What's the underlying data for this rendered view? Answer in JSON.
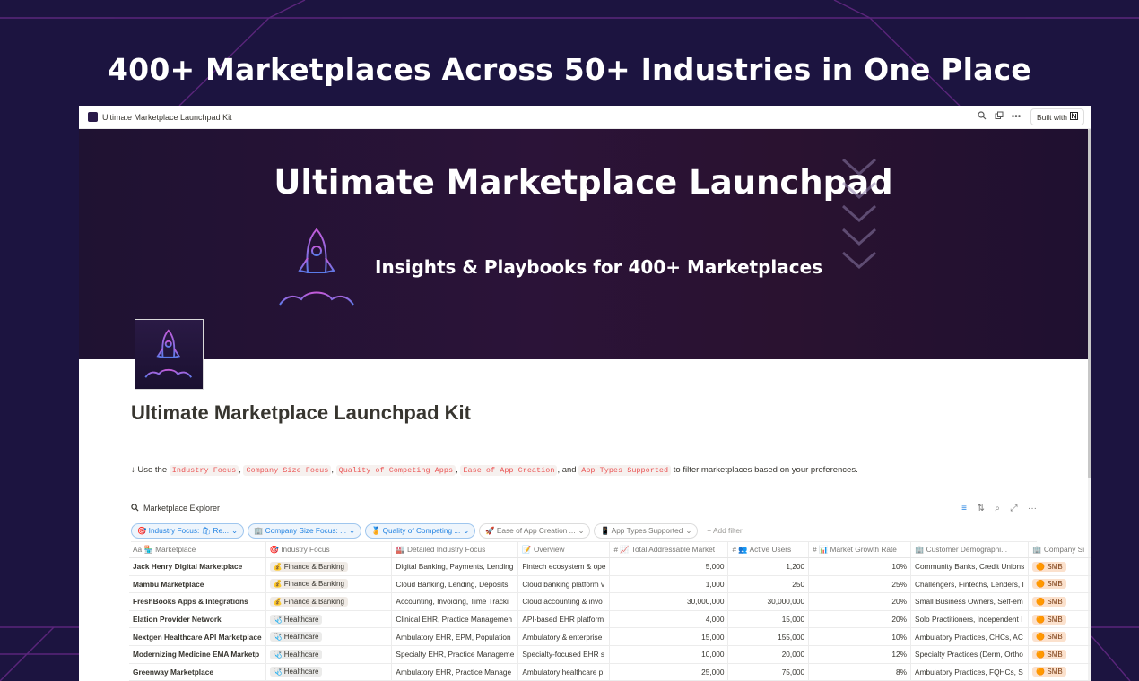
{
  "headline": "400+ Marketplaces Across 50+ Industries in One Place",
  "window": {
    "tab_title": "Ultimate Marketplace Launchpad Kit",
    "built_with_label": "Built with",
    "icons": [
      "search-icon",
      "duplicate-icon",
      "more-icon",
      "notion-logo-icon"
    ]
  },
  "banner": {
    "title": "Ultimate Marketplace Launchpad",
    "subtitle": "Insights & Playbooks for 400+ Marketplaces"
  },
  "page_title": "Ultimate Marketplace Launchpad Kit",
  "instructions": {
    "prefix": "↓ Use the",
    "tags": [
      "Industry Focus",
      "Company Size Focus",
      "Quality of Competing Apps",
      "Ease of App Creation",
      "App Types Supported"
    ],
    "sep": ",",
    "and": ", and",
    "suffix": "to filter marketplaces based on your preferences."
  },
  "database": {
    "title": "Marketplace Explorer",
    "filters": [
      {
        "label": "🎯 Industry Focus: 🛍 Re...",
        "active": true
      },
      {
        "label": "🏢 Company Size Focus: ...",
        "active": true
      },
      {
        "label": "🏅 Quality of Competing ...",
        "active": true
      },
      {
        "label": "🚀 Ease of App Creation ...",
        "active": false
      },
      {
        "label": "📱 App Types Supported",
        "active": false
      }
    ],
    "add_filter": "+ Add filter",
    "columns": [
      "Aa 🏪 Marketplace",
      "🎯 Industry Focus",
      "🏭 Detailed Industry Focus",
      "📝 Overview",
      "# 📈 Total Addressable Market",
      "# 👥 Active Users",
      "# 📊 Market Growth Rate",
      "🏢 Customer Demographi...",
      "🏢 Company Si"
    ],
    "rows": [
      {
        "marketplace": "Jack Henry Digital Marketplace",
        "industry": "💰 Finance & Banking",
        "detailed": "Digital Banking, Payments, Lending",
        "overview": "Fintech ecosystem & ope",
        "tam": "5,000",
        "users": "1,200",
        "growth": "10%",
        "demo": "Community Banks, Credit Unions",
        "size": "🟠 SMB"
      },
      {
        "marketplace": "Mambu Marketplace",
        "industry": "💰 Finance & Banking",
        "detailed": "Cloud Banking, Lending, Deposits,",
        "overview": "Cloud banking platform v",
        "tam": "1,000",
        "users": "250",
        "growth": "25%",
        "demo": "Challengers, Fintechs, Lenders, I",
        "size": "🟠 SMB"
      },
      {
        "marketplace": "FreshBooks Apps & Integrations",
        "industry": "💰 Finance & Banking",
        "detailed": "Accounting, Invoicing, Time Tracki",
        "overview": "Cloud accounting & invo",
        "tam": "30,000,000",
        "users": "30,000,000",
        "growth": "20%",
        "demo": "Small Business Owners, Self-em",
        "size": "🟠 SMB"
      },
      {
        "marketplace": "Elation Provider Network",
        "industry": "🩺 Healthcare",
        "detailed": "Clinical EHR, Practice Managemen",
        "overview": "API-based EHR platform",
        "tam": "4,000",
        "users": "15,000",
        "growth": "20%",
        "demo": "Solo Practitioners, Independent I",
        "size": "🟠 SMB"
      },
      {
        "marketplace": "Nextgen Healthcare API Marketplace",
        "industry": "🩺 Healthcare",
        "detailed": "Ambulatory EHR, EPM, Population",
        "overview": "Ambulatory & enterprise",
        "tam": "15,000",
        "users": "155,000",
        "growth": "10%",
        "demo": "Ambulatory Practices, CHCs, AC",
        "size": "🟠 SMB"
      },
      {
        "marketplace": "Modernizing Medicine EMA Marketp",
        "industry": "🩺 Healthcare",
        "detailed": "Specialty EHR, Practice Manageme",
        "overview": "Specialty-focused EHR s",
        "tam": "10,000",
        "users": "20,000",
        "growth": "12%",
        "demo": "Specialty Practices (Derm, Ortho",
        "size": "🟠 SMB"
      },
      {
        "marketplace": "Greenway Marketplace",
        "industry": "🩺 Healthcare",
        "detailed": "Ambulatory EHR, Practice Manage",
        "overview": "Ambulatory healthcare p",
        "tam": "25,000",
        "users": "75,000",
        "growth": "8%",
        "demo": "Ambulatory Practices, FQHCs, S",
        "size": "🟠 SMB"
      }
    ]
  },
  "colors": {
    "background": "#1c1440",
    "banner": "#2b1338",
    "filter_active": "#2383e2",
    "code_text": "#eb5757",
    "smb_tag": "#fbe1cd"
  }
}
